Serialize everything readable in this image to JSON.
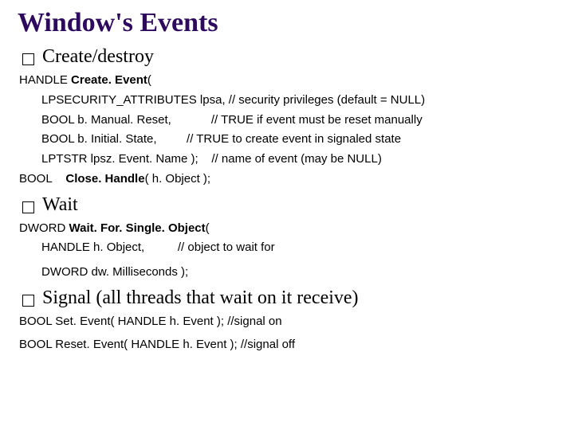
{
  "title": "Window's Events",
  "sections": {
    "create_destroy": {
      "label": "Create/destroy",
      "line1_pre": "HANDLE ",
      "line1_bold": "Create. Event",
      "line1_post": "(",
      "line2": "LPSECURITY_ATTRIBUTES lpsa, // security privileges (default = NULL)",
      "line3": "BOOL b. Manual. Reset,            // TRUE if event must be reset manually",
      "line4": "BOOL b. Initial. State,         // TRUE to create event in signaled state",
      "line5": "LPTSTR lpsz. Event. Name );    // name of event (may be NULL)",
      "line6_pre": "BOOL    ",
      "line6_bold": "Close. Handle",
      "line6_post": "( h. Object );"
    },
    "wait": {
      "label": "Wait",
      "line1_pre": "DWORD ",
      "line1_bold": "Wait. For. Single. Object",
      "line1_post": "(",
      "line2": "HANDLE h. Object,          // object to wait for",
      "line3": "DWORD dw. Milliseconds );"
    },
    "signal": {
      "label": "Signal (all threads that wait on it receive)",
      "line1": "BOOL Set. Event( HANDLE h. Event );  //signal on",
      "line2": "BOOL Reset. Event( HANDLE h. Event ); //signal off"
    }
  }
}
